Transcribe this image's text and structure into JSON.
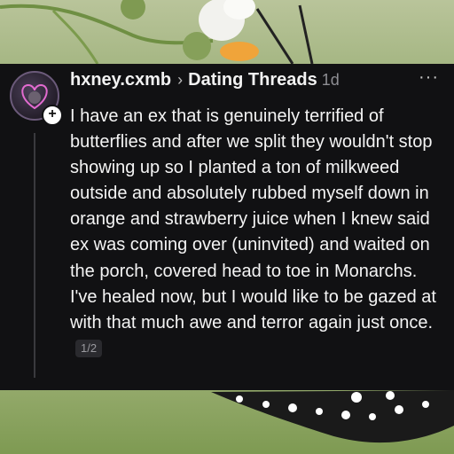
{
  "post": {
    "username": "hxney.cxmb",
    "separator": "›",
    "community": "Dating Threads",
    "age": "1d",
    "more_label": "···",
    "follow_badge": "+",
    "body": "I have an ex that is genuinely terrified of butterflies and after we split they wouldn't stop showing up so I planted a ton of milkweed outside and absolutely rubbed myself down in orange and strawberry juice when I knew said ex was coming over (uninvited) and waited on the porch, covered head to toe in Monarchs. I've healed now, but I would like to be gazed at with that much awe and terror again just once.",
    "page_indicator": "1/2"
  },
  "colors": {
    "card_background": "#111113",
    "text_primary": "#f4f4f4",
    "text_secondary": "#8e8e93",
    "background_foliage": "#9fb07a"
  },
  "icons": {
    "avatar": "profile-avatar",
    "follow": "plus-icon",
    "more": "more-icon"
  }
}
